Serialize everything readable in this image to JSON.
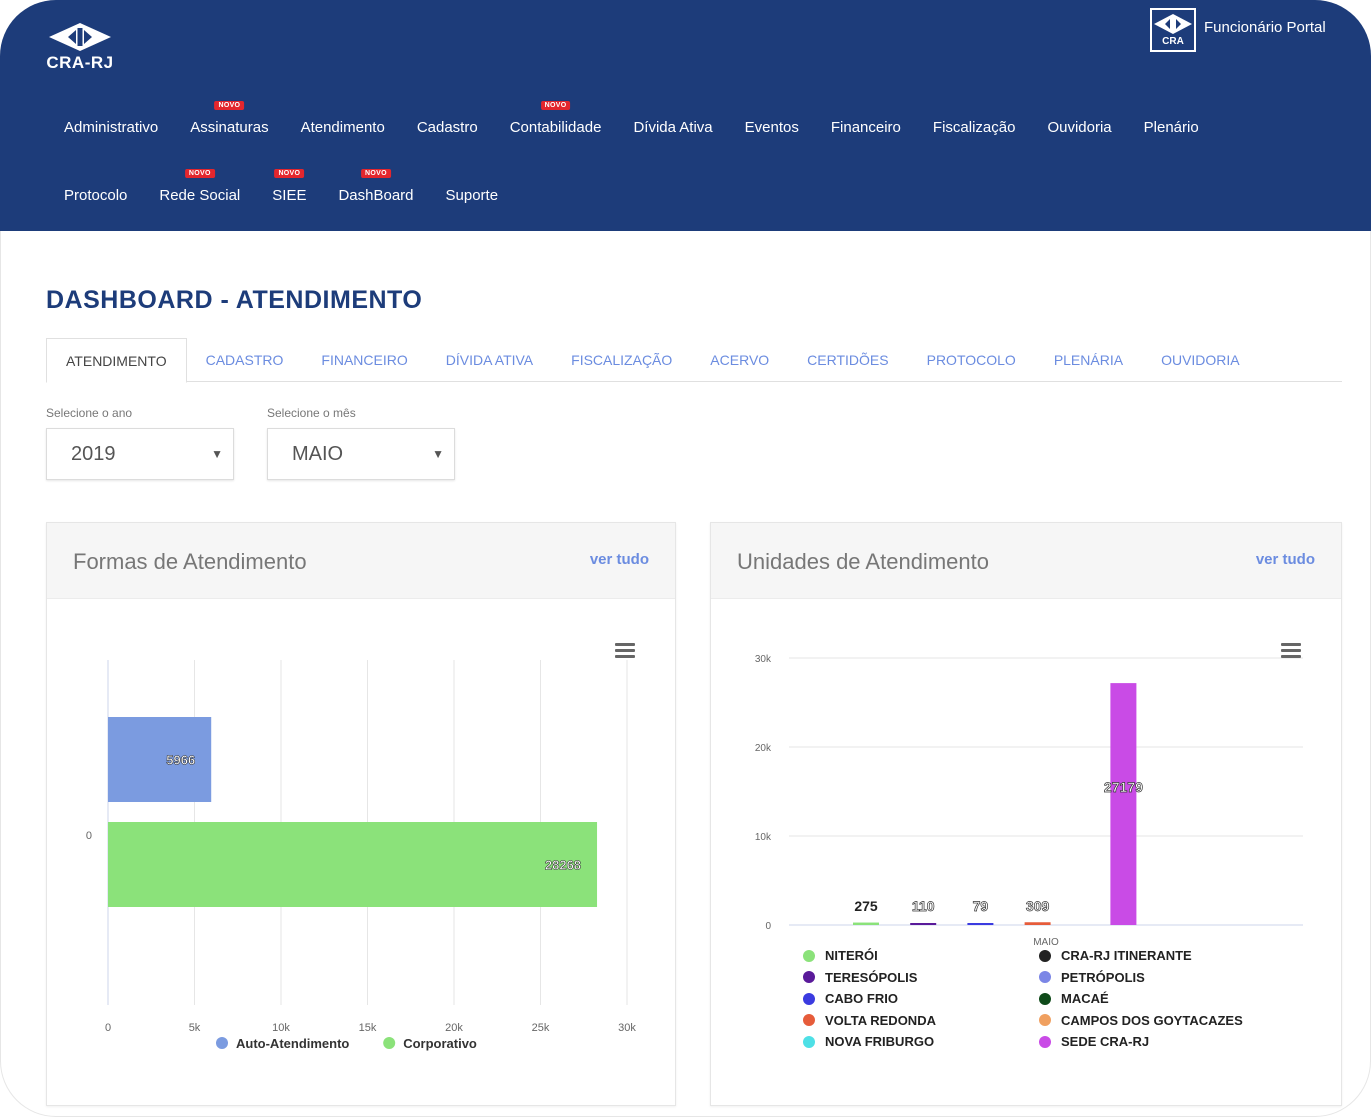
{
  "header": {
    "logo_text": "CRA-RJ",
    "portal_icon_label": "CRA",
    "portal_label": "Funcionário Portal",
    "nav_row1": [
      {
        "label": "Administrativo",
        "badge": ""
      },
      {
        "label": "Assinaturas",
        "badge": "NOVO"
      },
      {
        "label": "Atendimento",
        "badge": ""
      },
      {
        "label": "Cadastro",
        "badge": ""
      },
      {
        "label": "Contabilidade",
        "badge": "NOVO"
      },
      {
        "label": "Dívida Ativa",
        "badge": ""
      },
      {
        "label": "Eventos",
        "badge": ""
      },
      {
        "label": "Financeiro",
        "badge": ""
      },
      {
        "label": "Fiscalização",
        "badge": ""
      },
      {
        "label": "Ouvidoria",
        "badge": ""
      },
      {
        "label": "Plenário",
        "badge": ""
      }
    ],
    "nav_row2": [
      {
        "label": "Protocolo",
        "badge": ""
      },
      {
        "label": "Rede Social",
        "badge": "NOVO"
      },
      {
        "label": "SIEE",
        "badge": "NOVO"
      },
      {
        "label": "DashBoard",
        "badge": "NOVO"
      },
      {
        "label": "Suporte",
        "badge": ""
      }
    ]
  },
  "page": {
    "title": "DASHBOARD - ATENDIMENTO",
    "tabs": [
      "ATENDIMENTO",
      "CADASTRO",
      "FINANCEIRO",
      "DÍVIDA ATIVA",
      "FISCALIZAÇÃO",
      "ACERVO",
      "CERTIDÕES",
      "PROTOCOLO",
      "PLENÁRIA",
      "OUVIDORIA"
    ],
    "active_tab": "ATENDIMENTO",
    "filters": {
      "year_label": "Selecione o ano",
      "year_value": "2019",
      "month_label": "Selecione o mês",
      "month_value": "MAIO"
    }
  },
  "panels": {
    "left": {
      "title": "Formas de Atendimento",
      "link": "ver tudo"
    },
    "right": {
      "title": "Unidades de Atendimento",
      "link": "ver tudo"
    }
  },
  "chart_data": [
    {
      "type": "bar",
      "orientation": "horizontal",
      "categories": [
        "0"
      ],
      "x_ticks": [
        "0",
        "5k",
        "10k",
        "15k",
        "20k",
        "25k",
        "30k"
      ],
      "xlim": [
        0,
        30000
      ],
      "series": [
        {
          "name": "Auto-Atendimento",
          "values": [
            5966
          ],
          "label": "5966",
          "color": "#7b9be0"
        },
        {
          "name": "Corporativo",
          "values": [
            28268
          ],
          "label": "28268",
          "color": "#8be27a"
        }
      ],
      "legend": "bottom",
      "grid": true
    },
    {
      "type": "bar",
      "categories": [
        "MAIO"
      ],
      "y_ticks": [
        "0",
        "10k",
        "20k",
        "30k"
      ],
      "ylim": [
        0,
        30000
      ],
      "series": [
        {
          "name": "NITERÓI",
          "values": [
            275
          ],
          "label": "275",
          "color": "#8be27a"
        },
        {
          "name": "CRA-RJ ITINERANTE",
          "values": [
            0
          ],
          "label": "",
          "color": "#222222"
        },
        {
          "name": "TERESÓPOLIS",
          "values": [
            110
          ],
          "label": "110",
          "color": "#5a1a9a"
        },
        {
          "name": "PETRÓPOLIS",
          "values": [
            0
          ],
          "label": "",
          "color": "#7b86e6"
        },
        {
          "name": "CABO FRIO",
          "values": [
            79
          ],
          "label": "79",
          "color": "#3b3be0"
        },
        {
          "name": "MACAÉ",
          "values": [
            0
          ],
          "label": "",
          "color": "#0f4a1a"
        },
        {
          "name": "VOLTA REDONDA",
          "values": [
            309
          ],
          "label": "309",
          "color": "#e65c3a"
        },
        {
          "name": "CAMPOS DOS GOYTACAZES",
          "values": [
            0
          ],
          "label": "",
          "color": "#f0a060"
        },
        {
          "name": "NOVA FRIBURGO",
          "values": [
            0
          ],
          "label": "",
          "color": "#4ee0e6"
        },
        {
          "name": "SEDE CRA-RJ",
          "values": [
            27179
          ],
          "label": "27179",
          "color": "#c94be6"
        }
      ],
      "legend": "bottom",
      "grid": true
    }
  ]
}
